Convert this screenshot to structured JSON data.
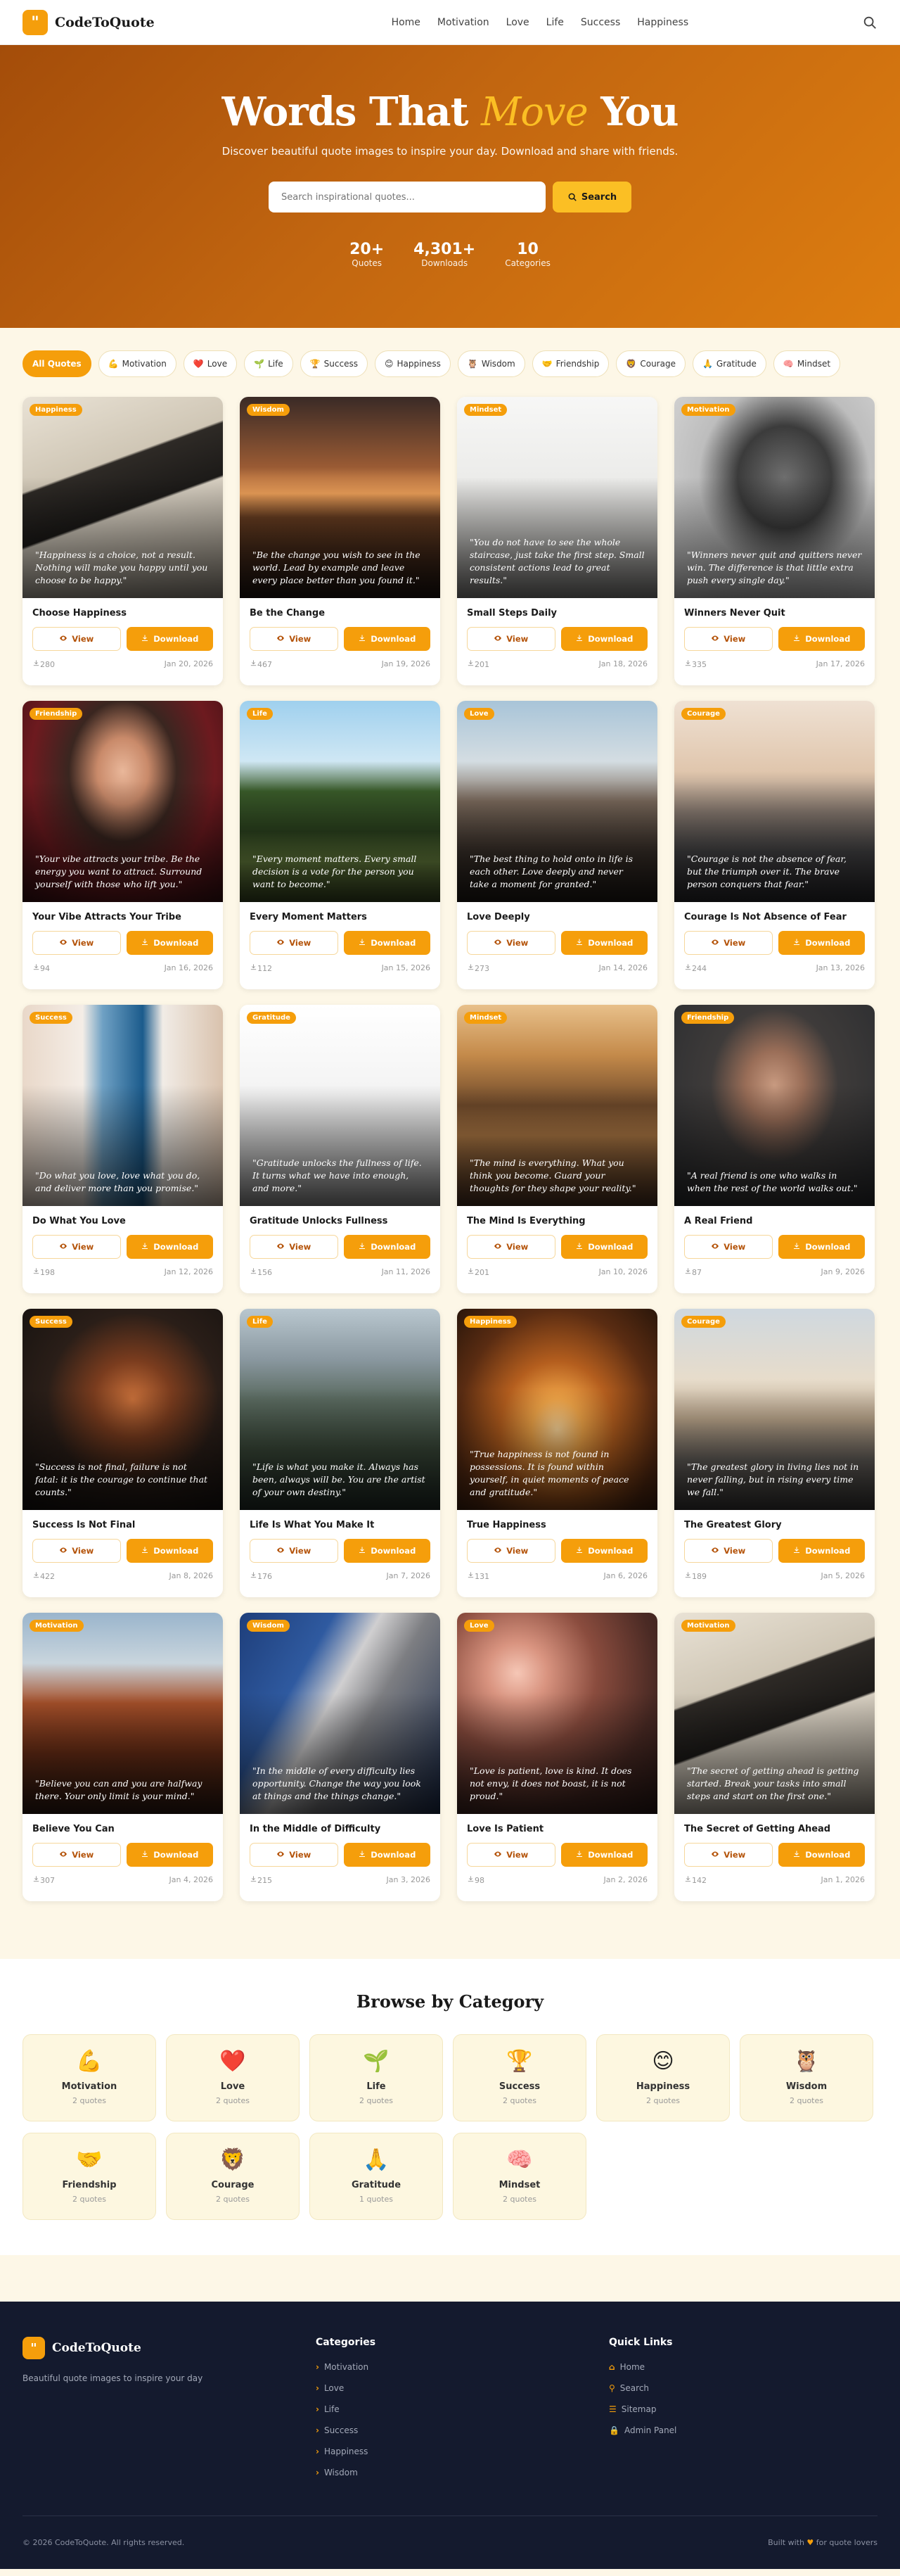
{
  "nav": {
    "logo_mark": "\"",
    "brand": "CodeToQuote",
    "links": [
      "Home",
      "Motivation",
      "Love",
      "Life",
      "Success",
      "Happiness"
    ]
  },
  "hero": {
    "title_pre": "Words That ",
    "title_em": "Move",
    "title_post": " You",
    "subtitle": "Discover beautiful quote images to inspire your day. Download and share with friends.",
    "search_placeholder": "Search inspirational quotes...",
    "search_button": "Search",
    "stats": [
      {
        "value": "20+",
        "label": "Quotes"
      },
      {
        "value": "4,301+",
        "label": "Downloads"
      },
      {
        "value": "10",
        "label": "Categories"
      }
    ]
  },
  "filters": [
    {
      "icon": "",
      "label": "All Quotes",
      "active": true
    },
    {
      "icon": "💪",
      "label": "Motivation"
    },
    {
      "icon": "❤️",
      "label": "Love"
    },
    {
      "icon": "🌱",
      "label": "Life"
    },
    {
      "icon": "🏆",
      "label": "Success"
    },
    {
      "icon": "😊",
      "label": "Happiness"
    },
    {
      "icon": "🦉",
      "label": "Wisdom"
    },
    {
      "icon": "🤝",
      "label": "Friendship"
    },
    {
      "icon": "🦁",
      "label": "Courage"
    },
    {
      "icon": "🙏",
      "label": "Gratitude"
    },
    {
      "icon": "🧠",
      "label": "Mindset"
    }
  ],
  "card_labels": {
    "view": "View",
    "download": "Download"
  },
  "quotes": [
    {
      "badge": "Happiness",
      "quote": "\"Happiness is a choice, not a result. Nothing will make you happy until you choose to be happy.\"",
      "title": "Choose Happiness",
      "downloads": "280",
      "date": "Jan 20, 2026",
      "bg": "linear-gradient(160deg,#e9e2d5 0%,#cfc6b5 35%,#2e2a26 36%,#1c1a18 55%,#d8d0c2 56%,#9d9588 100%)"
    },
    {
      "badge": "Wisdom",
      "quote": "\"Be the change you wish to see in the world. Lead by example and leave every place better than you found it.\"",
      "title": "Be the Change",
      "downloads": "467",
      "date": "Jan 19, 2026",
      "bg": "linear-gradient(180deg,#3a2a26 0%,#9a5b34 35%,#f2a35b 48%,#6b3f22 60%,#1e1410 100%)"
    },
    {
      "badge": "Mindset",
      "quote": "\"You do not have to see the whole staircase, just take the first step. Small consistent actions lead to great results.\"",
      "title": "Small Steps Daily",
      "downloads": "201",
      "date": "Jan 18, 2026",
      "bg": "linear-gradient(180deg,#f7f7f6 0%,#ececea 40%,#c9c8c5 70%,#8c8b88 100%)"
    },
    {
      "badge": "Motivation",
      "quote": "\"Winners never quit and quitters never win. The difference is that little extra push every single day.\"",
      "title": "Winners Never Quit",
      "downloads": "335",
      "date": "Jan 17, 2026",
      "bg": "radial-gradient(ellipse at 55% 40%,#6e6e6e 0%,#3b3b3b 30%,#bdbdbd 55%,#d9d9d9 100%)"
    },
    {
      "badge": "Friendship",
      "quote": "\"Your vibe attracts your tribe. Be the energy you want to attract. Surround yourself with those who lift you.\"",
      "title": "Your Vibe Attracts Your Tribe",
      "downloads": "94",
      "date": "Jan 16, 2026",
      "bg": "radial-gradient(ellipse at 50% 35%,#e9b79a 0%,#c98a6a 18%,#3a2620 38%,#6d1a1f 65%,#3a0f13 100%)"
    },
    {
      "badge": "Life",
      "quote": "\"Every moment matters. Every small decision is a vote for the person you want to become.\"",
      "title": "Every Moment Matters",
      "downloads": "112",
      "date": "Jan 15, 2026",
      "bg": "linear-gradient(180deg,#9fd0ee 0%,#cfe7f4 30%,#3a5c2a 45%,#2e4620 65%,#6f8a43 80%,#3a4a22 100%)"
    },
    {
      "badge": "Love",
      "quote": "\"The best thing to hold onto in life is each other. Love deeply and never take a moment for granted.\"",
      "title": "Love Deeply",
      "downloads": "273",
      "date": "Jan 14, 2026",
      "bg": "linear-gradient(180deg,#a8c4d8 0%,#d4dde2 30%,#7c6b5d 50%,#3f352e 75%,#1f1a16 100%)"
    },
    {
      "badge": "Courage",
      "quote": "\"Courage is not the absence of fear, but the triumph over it. The brave person conquers that fear.\"",
      "title": "Courage Is Not Absence of Fear",
      "downloads": "244",
      "date": "Jan 13, 2026",
      "bg": "linear-gradient(180deg,#efe1d3 0%,#e0c6ad 35%,#8a7c72 55%,#4b4a4c 75%,#2a2a2e 100%)"
    },
    {
      "badge": "Success",
      "quote": "\"Do what you love, love what you do, and deliver more than you promise.\"",
      "title": "Do What You Love",
      "downloads": "198",
      "date": "Jan 12, 2026",
      "bg": "linear-gradient(90deg,#e9d8c9 0%,#f4ede6 30%,#6fa1c4 40%,#1b5b8c 60%,#f1ece6 70%,#d9c2ad 100%)"
    },
    {
      "badge": "Gratitude",
      "quote": "\"Gratitude unlocks the fullness of life. It turns what we have into enough, and more.\"",
      "title": "Gratitude Unlocks Fullness",
      "downloads": "156",
      "date": "Jan 11, 2026",
      "bg": "linear-gradient(180deg,#ffffff 0%,#f3f3f3 45%,#cfcfcf 75%,#9a9a9a 100%)"
    },
    {
      "badge": "Mindset",
      "quote": "\"The mind is everything. What you think you become. Guard your thoughts for they shape your reality.\"",
      "title": "The Mind Is Everything",
      "downloads": "201",
      "date": "Jan 10, 2026",
      "bg": "linear-gradient(180deg,#e8c08a 0%,#c48a4a 25%,#6f4a2b 50%,#b07a45 65%,#4a3020 100%)"
    },
    {
      "badge": "Friendship",
      "quote": "\"A real friend is one who walks in when the rest of the world walks out.\"",
      "title": "A Real Friend",
      "downloads": "87",
      "date": "Jan 9, 2026",
      "bg": "radial-gradient(ellipse at 50% 40%,#c89a80 0%,#9a6e58 20%,#3e3b3a 45%,#2a2c2f 100%)"
    },
    {
      "badge": "Success",
      "quote": "\"Success is not final, failure is not fatal: it is the courage to continue that counts.\"",
      "title": "Success Is Not Final",
      "downloads": "422",
      "date": "Jan 8, 2026",
      "bg": "radial-gradient(ellipse at 55% 45%,#c8703a 0%,#7a3c1e 25%,#2a1e18 55%,#14110f 100%)"
    },
    {
      "badge": "Life",
      "quote": "\"Life is what you make it. Always has been, always will be. You are the artist of your own destiny.\"",
      "title": "Life Is What You Make It",
      "downloads": "176",
      "date": "Jan 7, 2026",
      "bg": "linear-gradient(180deg,#b9c7cf 0%,#8a98a0 25%,#5a6a60 45%,#3b4a3a 70%,#25302a 100%)"
    },
    {
      "badge": "Happiness",
      "quote": "\"True happiness is not found in possessions. It is found within yourself, in quiet moments of peace and gratitude.\"",
      "title": "True Happiness",
      "downloads": "131",
      "date": "Jan 6, 2026",
      "bg": "radial-gradient(ellipse at 50% 60%,#ffd89a 0%,#f0a447 18%,#b45e1e 40%,#5a2c12 70%,#2a160a 100%)"
    },
    {
      "badge": "Courage",
      "quote": "\"The greatest glory in living lies not in never falling, but in rising every time we fall.\"",
      "title": "The Greatest Glory",
      "downloads": "189",
      "date": "Jan 5, 2026",
      "bg": "linear-gradient(180deg,#cfd8df 0%,#e7dccb 35%,#b9a48a 55%,#6a6560 75%,#3d3b3a 100%)"
    },
    {
      "badge": "Motivation",
      "quote": "\"Believe you can and you are halfway there. Your only limit is your mind.\"",
      "title": "Believe You Can",
      "downloads": "307",
      "date": "Jan 4, 2026",
      "bg": "linear-gradient(180deg,#9ab5cc 0%,#c9d5dd 25%,#a6502a 45%,#6b2e16 70%,#2e1a12 100%)"
    },
    {
      "badge": "Wisdom",
      "quote": "\"In the middle of every difficulty lies opportunity. Change the way you look at things and the things change.\"",
      "title": "In the Middle of Difficulty",
      "downloads": "215",
      "date": "Jan 3, 2026",
      "bg": "linear-gradient(120deg,#1e3e7a 0%,#2f5aa0 30%,#d0cfd0 45%,#7d7e82 60%,#1a2a4a 100%)"
    },
    {
      "badge": "Love",
      "quote": "\"Love is patient, love is kind. It does not envy, it does not boast, it is not proud.\"",
      "title": "Love Is Patient",
      "downloads": "98",
      "date": "Jan 2, 2026",
      "bg": "radial-gradient(circle at 30% 30%,#f6c7b6 0%,#d99480 15%,#8a4c3e 40%,#4a2a24 70%,#2a1816 100%)"
    },
    {
      "badge": "Motivation",
      "quote": "\"The secret of getting ahead is getting started. Break your tasks into small steps and start on the first one.\"",
      "title": "The Secret of Getting Ahead",
      "downloads": "142",
      "date": "Jan 1, 2026",
      "bg": "linear-gradient(160deg,#e9e2d5 0%,#cfc6b5 35%,#2e2a26 36%,#1c1a18 55%,#d8d0c2 56%,#9d9588 100%)"
    }
  ],
  "categories_section": {
    "title": "Browse by Category",
    "items": [
      {
        "icon": "💪",
        "name": "Motivation",
        "count": "2 quotes"
      },
      {
        "icon": "❤️",
        "name": "Love",
        "count": "2 quotes"
      },
      {
        "icon": "🌱",
        "name": "Life",
        "count": "2 quotes"
      },
      {
        "icon": "🏆",
        "name": "Success",
        "count": "2 quotes"
      },
      {
        "icon": "😊",
        "name": "Happiness",
        "count": "2 quotes"
      },
      {
        "icon": "🦉",
        "name": "Wisdom",
        "count": "2 quotes"
      },
      {
        "icon": "🤝",
        "name": "Friendship",
        "count": "2 quotes"
      },
      {
        "icon": "🦁",
        "name": "Courage",
        "count": "2 quotes"
      },
      {
        "icon": "🙏",
        "name": "Gratitude",
        "count": "1 quotes"
      },
      {
        "icon": "🧠",
        "name": "Mindset",
        "count": "2 quotes"
      }
    ]
  },
  "footer": {
    "brand": "CodeToQuote",
    "tagline": "Beautiful quote images to inspire your day",
    "categories_title": "Categories",
    "categories": [
      "Motivation",
      "Love",
      "Life",
      "Success",
      "Happiness",
      "Wisdom"
    ],
    "quick_title": "Quick Links",
    "quick_links": [
      {
        "icon": "⌂",
        "label": "Home"
      },
      {
        "icon": "⚲",
        "label": "Search"
      },
      {
        "icon": "☰",
        "label": "Sitemap"
      },
      {
        "icon": "🔒",
        "label": "Admin Panel"
      }
    ],
    "copyright": "© 2026 CodeToQuote. All rights reserved.",
    "built_pre": "Built with",
    "built_post": "for quote lovers"
  },
  "colors": {
    "accent": "#f59e0b",
    "hero_start": "#a44d0a",
    "hero_end": "#dd7d10",
    "footer_bg": "#141a2e"
  }
}
